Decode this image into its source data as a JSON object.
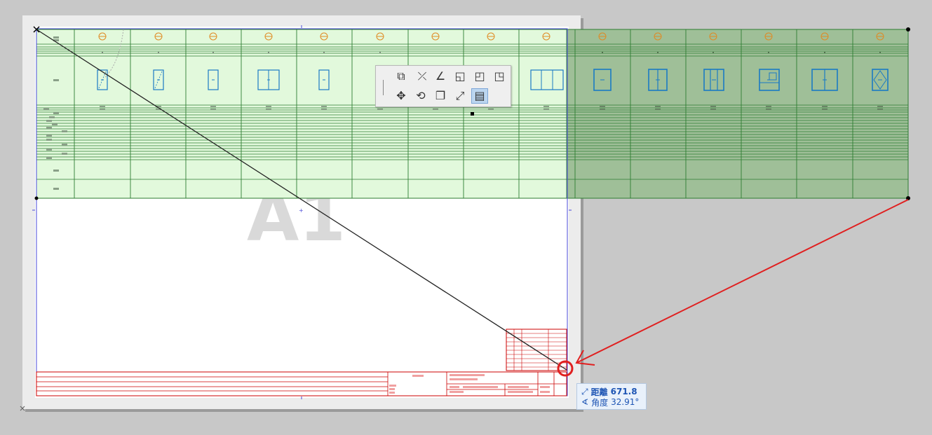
{
  "canvas": {
    "sheet_label": "A1",
    "colors": {
      "background": "#c8c8c8",
      "sheet": "#ececec",
      "paper": "#ffffff",
      "schedule_fill": "#e2f9dc",
      "schedule_line": "#2e7d32",
      "dragged_fill": "#9fbf98",
      "titleblock": "#cc0000",
      "door_icon": "#1a7ac4",
      "orange_symbol": "#e08a22",
      "selection_frame": "#4a4ad8",
      "arrow": "#e02020",
      "diagonal": "#222222"
    }
  },
  "toolbar": {
    "buttons": [
      {
        "name": "drag-icon",
        "glyph": "⧉"
      },
      {
        "name": "offset-icon",
        "glyph": "⤫"
      },
      {
        "name": "angle-icon",
        "glyph": "∠"
      },
      {
        "name": "fillet-icon",
        "glyph": "◱"
      },
      {
        "name": "add-point-icon",
        "glyph": "◰"
      },
      {
        "name": "subtract-point-icon",
        "glyph": "◳"
      },
      {
        "name": "move-icon",
        "glyph": "✥"
      },
      {
        "name": "rotate-icon",
        "glyph": "⟲"
      },
      {
        "name": "copy-icon",
        "glyph": "❐"
      },
      {
        "name": "resize-icon",
        "glyph": "⤢"
      },
      {
        "name": "stretch-schedule-icon",
        "glyph": "▤"
      }
    ]
  },
  "tooltip": {
    "distance_icon": "⤢",
    "distance_label": "距離",
    "distance_value": "671.8",
    "angle_icon": "∢",
    "angle_label": "角度",
    "angle_value": "32.91°"
  }
}
